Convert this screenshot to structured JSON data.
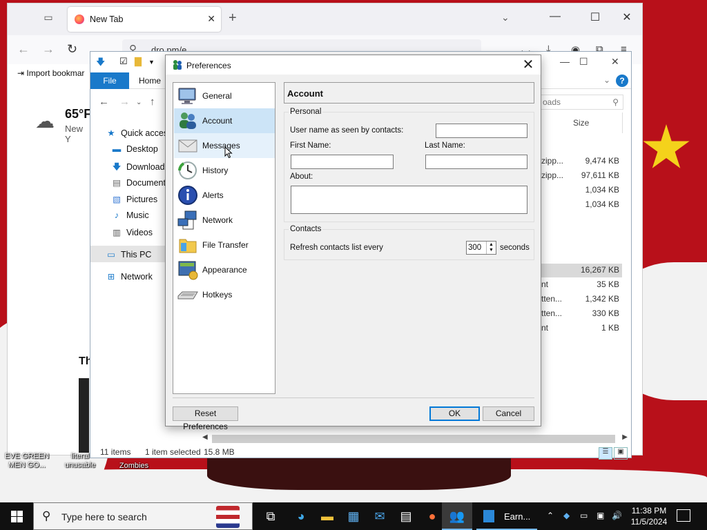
{
  "browser": {
    "tab_title": "New Tab",
    "url": "dro.pm/e",
    "bookmark_import": "Import bookmar",
    "weather_temp": "65°F",
    "weather_location": "New Y",
    "section_title": "Th"
  },
  "explorer": {
    "ribbon_file": "File",
    "ribbon_home": "Home",
    "search_placeholder": "oads",
    "nav": [
      {
        "label": "Quick access",
        "icon": "star-icon"
      },
      {
        "label": "Desktop",
        "icon": "desktop-icon"
      },
      {
        "label": "Downloads",
        "icon": "download-icon"
      },
      {
        "label": "Documents",
        "icon": "documents-icon"
      },
      {
        "label": "Pictures",
        "icon": "pictures-icon"
      },
      {
        "label": "Music",
        "icon": "music-icon"
      },
      {
        "label": "Videos",
        "icon": "videos-icon"
      },
      {
        "label": "This PC",
        "icon": "computer-icon"
      },
      {
        "label": "Network",
        "icon": "network-icon"
      }
    ],
    "size_header": "Size",
    "files": [
      {
        "name": "zipp...",
        "size": "9,474 KB"
      },
      {
        "name": "zipp...",
        "size": "97,611 KB"
      },
      {
        "name": "",
        "size": "1,034 KB"
      },
      {
        "name": "",
        "size": "1,034 KB"
      },
      {
        "name": "",
        "size": "16,267 KB"
      },
      {
        "name": "nt",
        "size": "35 KB"
      },
      {
        "name": "tten...",
        "size": "1,342 KB"
      },
      {
        "name": "tten...",
        "size": "330 KB"
      },
      {
        "name": "nt",
        "size": "1 KB"
      }
    ],
    "status_items": "11 items",
    "status_selected": "1 item selected",
    "status_size": "15.8 MB"
  },
  "prefs": {
    "title": "Preferences",
    "categories": [
      {
        "label": "General",
        "icon": "monitor-icon"
      },
      {
        "label": "Account",
        "icon": "users-icon"
      },
      {
        "label": "Messages",
        "icon": "envelope-icon"
      },
      {
        "label": "History",
        "icon": "clock-icon"
      },
      {
        "label": "Alerts",
        "icon": "info-icon"
      },
      {
        "label": "Network",
        "icon": "network-computers-icon"
      },
      {
        "label": "File Transfer",
        "icon": "folder-icon"
      },
      {
        "label": "Appearance",
        "icon": "appearance-icon"
      },
      {
        "label": "Hotkeys",
        "icon": "keyboard-icon"
      }
    ],
    "selected_category": "Account",
    "panel_title": "Account",
    "personal_group": "Personal",
    "username_label": "User name as seen by contacts:",
    "username_value": "",
    "first_name_label": "First Name:",
    "first_name_value": "",
    "last_name_label": "Last Name:",
    "last_name_value": "",
    "about_label": "About:",
    "about_value": "",
    "contacts_group": "Contacts",
    "refresh_label": "Refresh contacts list every",
    "refresh_value": "300",
    "refresh_unit": "seconds",
    "reset_button": "Reset Preferences",
    "ok_button": "OK",
    "cancel_button": "Cancel"
  },
  "desktop_labels": [
    {
      "text": "EVE GREEN\nMEN GO..."
    },
    {
      "text": "literal\nunusable"
    },
    {
      "text": "Zombies"
    }
  ],
  "taskbar": {
    "search_placeholder": "Type here to search",
    "earn_label": "Earn...",
    "time": "11:38 PM",
    "date": "11/5/2024"
  },
  "colors": {
    "accent": "#0078d7",
    "selected_item": "#cce4f7",
    "explorer_file_tab": "#1979ca",
    "wallpaper_red": "#b8101a"
  }
}
